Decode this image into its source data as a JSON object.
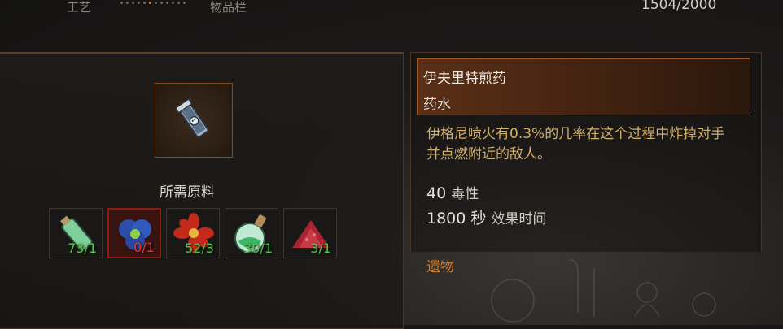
{
  "topbar": {
    "tab_crafting": "工艺",
    "tab_inventory": "物品栏",
    "weight": "1504/2000"
  },
  "recipe": {
    "item_icon": "potion-bottle-icon",
    "required_label": "所需原料",
    "ingredients": [
      {
        "icon": "green-flask-icon",
        "count": "73/1",
        "status": "ok"
      },
      {
        "icon": "blue-orbs-icon",
        "count": "0/1",
        "status": "missing"
      },
      {
        "icon": "red-flower-icon",
        "count": "52/3",
        "status": "ok"
      },
      {
        "icon": "green-round-flask-icon",
        "count": "30/1",
        "status": "ok"
      },
      {
        "icon": "red-powder-icon",
        "count": "3/1",
        "status": "ok"
      }
    ]
  },
  "details": {
    "name": "伊夫里特煎药",
    "type": "药水",
    "description": "伊格尼喷火有0.3%的几率在这个过程中炸掉对手并点燃附近的敌人。",
    "stats": [
      {
        "value": "40",
        "label": "毒性"
      },
      {
        "value": "1800 秒",
        "label": "效果时间"
      }
    ],
    "rarity": "遗物"
  },
  "colors": {
    "accent": "#d4802f",
    "ok": "#56c14d",
    "missing": "#d83c2e",
    "description": "#d3b06a"
  }
}
